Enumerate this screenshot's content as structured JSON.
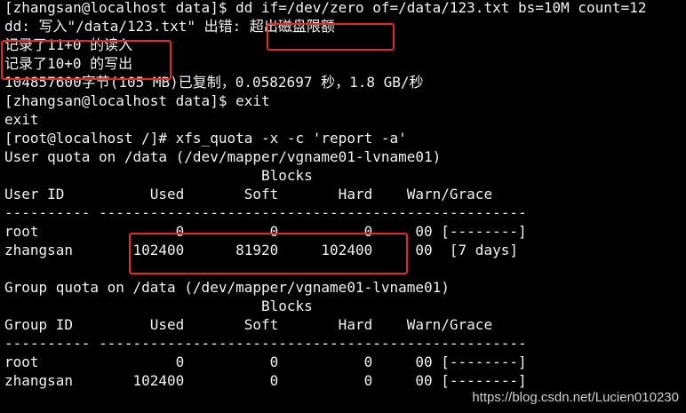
{
  "terminal": {
    "lines": [
      "[zhangsan@localhost data]$ dd if=/dev/zero of=/data/123.txt bs=10M count=12",
      "dd: 写入\"/data/123.txt\" 出错: 超出磁盘限额",
      "记录了11+0 的读入",
      "记录了10+0 的写出",
      "104857600字节(105 MB)已复制，0.0582697 秒，1.8 GB/秒",
      "[zhangsan@localhost data]$ exit",
      "exit",
      "[root@localhost /]# xfs_quota -x -c 'report -a'",
      "User quota on /data (/dev/mapper/vgname01-lvname01)",
      "                              Blocks",
      "User ID          Used       Soft       Hard    Warn/Grace",
      "---------- --------------------------------------------------",
      "root                0          0          0     00 [--------]",
      "zhangsan       102400      81920     102400     00  [7 days]",
      "",
      "Group quota on /data (/dev/mapper/vgname01-lvname01)",
      "                              Blocks",
      "Group ID         Used       Soft       Hard    Warn/Grace",
      "---------- --------------------------------------------------",
      "root                0          0          0     00 [--------]",
      "zhangsan       102400          0          0     00 [--------]"
    ]
  },
  "highlight_color": "#e8262b",
  "watermark": "https://blog.csdn.net/Lucien010230"
}
